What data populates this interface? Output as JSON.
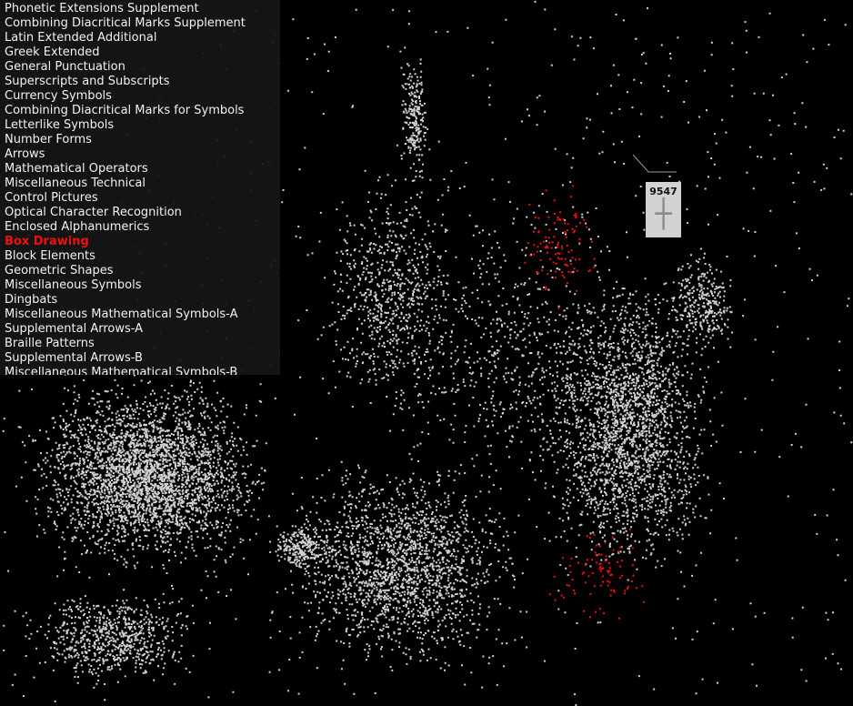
{
  "categories": [
    "Phonetic Extensions Supplement",
    "Combining Diacritical Marks Supplement",
    "Latin Extended Additional",
    "Greek Extended",
    "General Punctuation",
    "Superscripts and Subscripts",
    "Currency Symbols",
    "Combining Diacritical Marks for Symbols",
    "Letterlike Symbols",
    "Number Forms",
    "Arrows",
    "Mathematical Operators",
    "Miscellaneous Technical",
    "Control Pictures",
    "Optical Character Recognition",
    "Enclosed Alphanumerics",
    "Box Drawing",
    "Block Elements",
    "Geometric Shapes",
    "Miscellaneous Symbols",
    "Dingbats",
    "Miscellaneous Mathematical Symbols-A",
    "Supplemental Arrows-A",
    "Braille Patterns",
    "Supplemental Arrows-B",
    "Miscellaneous Mathematical Symbols-B"
  ],
  "selected_category": "Box Drawing",
  "tooltip": {
    "count": "9547",
    "glyph": "┼"
  },
  "colors": {
    "background": "#000000",
    "point": "#d2d2d2",
    "highlight": "#ee1111",
    "panel": "#161616"
  }
}
